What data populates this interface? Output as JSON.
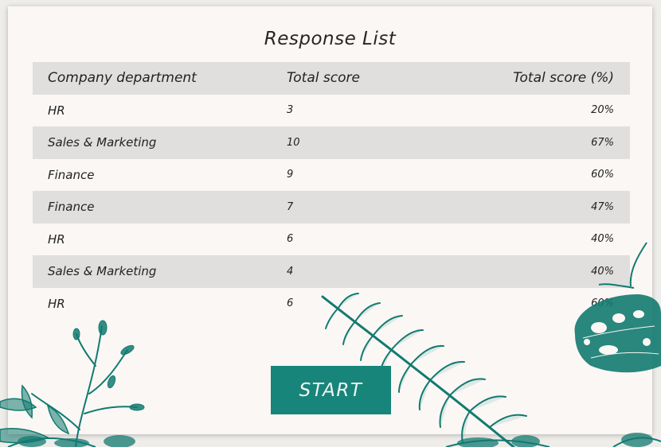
{
  "title": "Response List",
  "columns": [
    "Company department",
    "Total score",
    "Total score (%)"
  ],
  "rows": [
    {
      "department": "HR",
      "score": "3",
      "percent": "20%"
    },
    {
      "department": "Sales & Marketing",
      "score": "10",
      "percent": "67%"
    },
    {
      "department": "Finance",
      "score": "9",
      "percent": "60%"
    },
    {
      "department": "Finance",
      "score": "7",
      "percent": "47%"
    },
    {
      "department": "HR",
      "score": "6",
      "percent": "40%"
    },
    {
      "department": "Sales & Marketing",
      "score": "4",
      "percent": "40%"
    },
    {
      "department": "HR",
      "score": "6",
      "percent": "60%"
    }
  ],
  "start_label": "START",
  "colors": {
    "accent": "#17857a",
    "card_background": "#faf7f4",
    "row_shade": "#e0dfdd",
    "foliage": "#127a70"
  },
  "decorations": [
    "fern-leaf-icon",
    "flower-sprig-icon",
    "butterfly-icon",
    "bottom-foliage-icon"
  ]
}
